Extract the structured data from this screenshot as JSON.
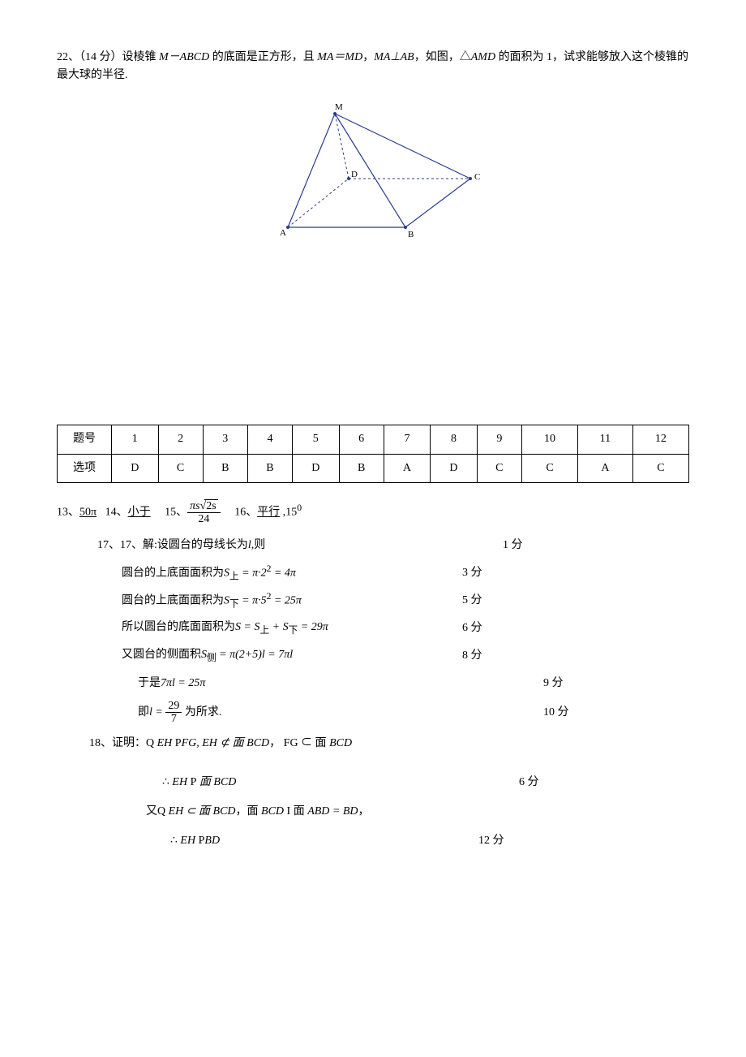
{
  "q22": {
    "number": "22、",
    "points": "（14 分）",
    "text1": "设棱锥 ",
    "pyramid": "M－ABCD",
    "text2": " 的底面是正方形，且 ",
    "eq1": "MA＝MD",
    "comma": "，",
    "eq2": "MA⊥AB",
    "text3": "，如图，△",
    "triangle": "AMD",
    "text4": " 的面积为 1，试求能够放入这个棱锥的最大球的半径.",
    "figLabels": {
      "M": "M",
      "A": "A",
      "B": "B",
      "C": "C",
      "D": "D"
    }
  },
  "table": {
    "header_label": "题号",
    "answer_label": "选项",
    "headers": [
      "1",
      "2",
      "3",
      "4",
      "5",
      "6",
      "7",
      "8",
      "9",
      "10",
      "11",
      "12"
    ],
    "answers": [
      "D",
      "C",
      "B",
      "B",
      "D",
      "B",
      "A",
      "D",
      "C",
      "C",
      "A",
      "C"
    ]
  },
  "fill": {
    "n13": "13、",
    "a13": "50π",
    "n14": "14、",
    "a14": "小于",
    "n15": "15、",
    "a15_num_prefix": "πs",
    "a15_num_rad": "2s",
    "a15_den": "24",
    "n16": "16、",
    "a16a": "平行",
    "a16b": " ,15",
    "a16sup": "0"
  },
  "s17": {
    "label": "17、17、解:设圆台的母线长为",
    "l_var": "l",
    "label_end": ",则",
    "score0": "1 分",
    "line1a": "圆台的上底面面积为",
    "line1b": "S",
    "line1c": "上",
    "line1d": " = π·2",
    "line1e": "2",
    "line1f": " = 4π",
    "score1": "3 分",
    "line2a": "圆台的上底面面积为",
    "line2b": "S",
    "line2c": "下",
    "line2d": " = π·5",
    "line2e": "2",
    "line2f": " = 25π",
    "score2": "5 分",
    "line3a": "所以圆台的底面面积为",
    "line3b": "S = S",
    "line3c": "上",
    "line3d": " + S",
    "line3e": "下",
    "line3f": " = 29π",
    "score3": "6 分",
    "line4a": "又圆台的侧面积",
    "line4b": "S",
    "line4c": "侧",
    "line4d": " = π(2+5)l = 7πl",
    "score4": "8 分",
    "line5a": "于是",
    "line5b": "7πl = 25π",
    "score5": "9 分",
    "line6a": "即",
    "line6b": "l = ",
    "line6num": "29",
    "line6den": "7",
    "line6c": " 为所求.",
    "score6": "10 分"
  },
  "s18": {
    "label": "18、证明：",
    "sym_because": "Q",
    "p1a": "EH",
    "sym_parallel": "P",
    "p1b": "FG, EH ⊄ 面",
    "p1c": "BCD",
    "p1d": "，  FG ⊂ 面 ",
    "p1e": "BCD",
    "therefore": "∴",
    "p2a": "EH ",
    "p2b": " 面 BCD",
    "score1": "6 分",
    "p3a": "又",
    "p3b": "EH ⊂ 面",
    "p3c": "BCD",
    "p3d": "，面 ",
    "p3e": "BCD ",
    "sym_cap": "I",
    "p3f": " 面 ",
    "p3g": "ABD = BD",
    "p3h": "，",
    "p4a": "EH ",
    "p4b": "BD",
    "score2": "12 分"
  }
}
